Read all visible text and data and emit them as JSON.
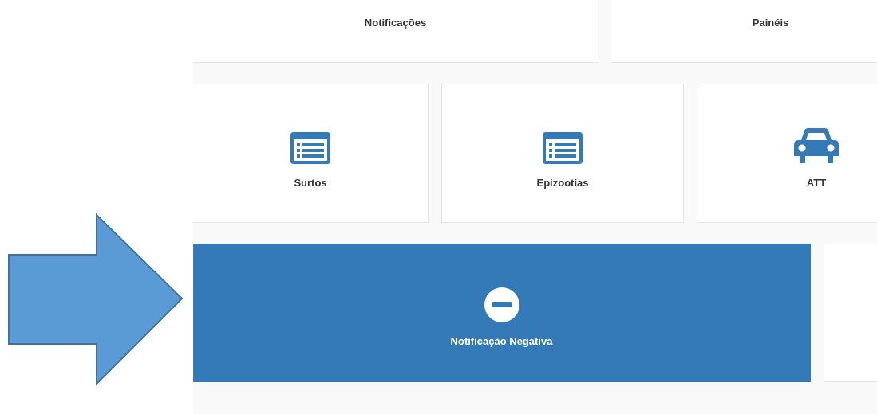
{
  "top_tiles": [
    {
      "label": "Notificações"
    },
    {
      "label": "Painéis"
    }
  ],
  "tiles": [
    {
      "label": "Surtos",
      "kind": "list"
    },
    {
      "label": "Epizootias",
      "kind": "list"
    },
    {
      "label": "ATT",
      "kind": "car"
    }
  ],
  "bottom_tiles": [
    {
      "label": "Notificação Negativa",
      "kind": "minus",
      "selected": true
    },
    {
      "kind": "blank",
      "selected": false
    }
  ]
}
